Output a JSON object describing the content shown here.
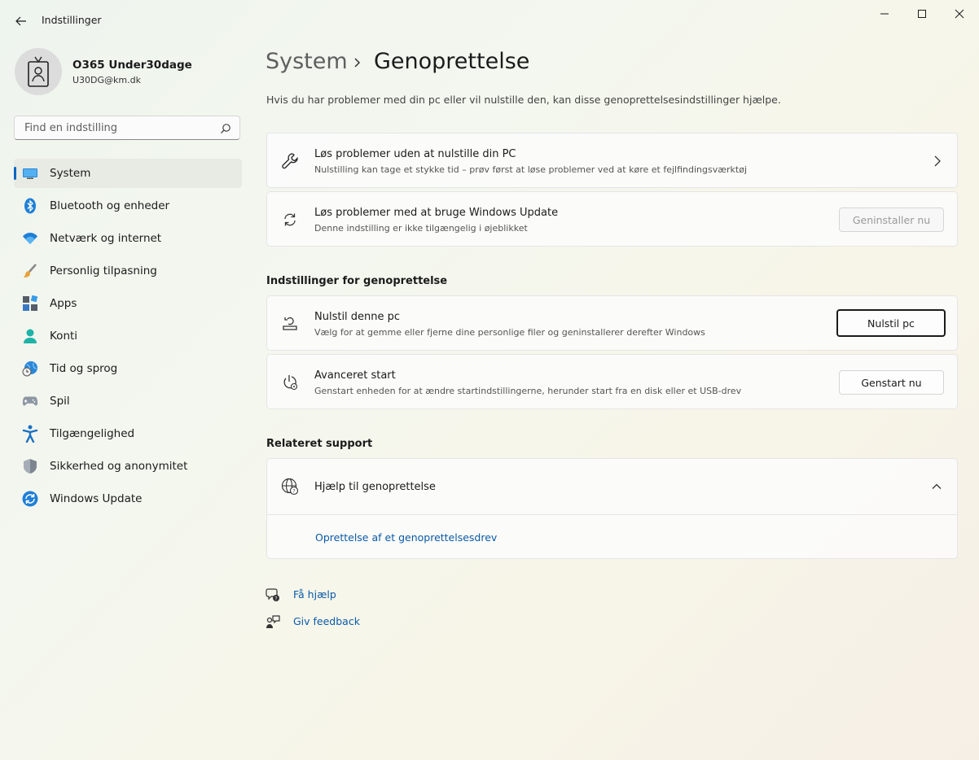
{
  "window": {
    "title": "Indstillinger"
  },
  "profile": {
    "name": "O365 Under30dage",
    "email": "U30DG@km.dk"
  },
  "search": {
    "placeholder": "Find en indstilling"
  },
  "nav": {
    "items": [
      {
        "label": "System",
        "icon": "system-icon",
        "active": true
      },
      {
        "label": "Bluetooth og enheder",
        "icon": "bluetooth-icon"
      },
      {
        "label": "Netværk og internet",
        "icon": "wifi-icon"
      },
      {
        "label": "Personlig tilpasning",
        "icon": "brush-icon"
      },
      {
        "label": "Apps",
        "icon": "apps-icon"
      },
      {
        "label": "Konti",
        "icon": "account-icon"
      },
      {
        "label": "Tid og sprog",
        "icon": "time-language-icon"
      },
      {
        "label": "Spil",
        "icon": "gamepad-icon"
      },
      {
        "label": "Tilgængelighed",
        "icon": "accessibility-icon"
      },
      {
        "label": "Sikkerhed og anonymitet",
        "icon": "shield-icon"
      },
      {
        "label": "Windows Update",
        "icon": "windows-update-icon"
      }
    ]
  },
  "header": {
    "breadcrumb_parent": "System",
    "breadcrumb_current": "Genoprettelse",
    "intro": "Hvis du har problemer med din pc eller vil nulstille den, kan disse genoprettelsesindstillinger hjælpe."
  },
  "cards": {
    "troubleshoot": {
      "title": "Løs problemer uden at nulstille din PC",
      "desc": "Nulstilling kan tage et stykke tid – prøv først at løse problemer ved at køre et fejlfindingsværktøj"
    },
    "windows_update": {
      "title": "Løs problemer med at bruge Windows Update",
      "desc": "Denne indstilling er ikke tilgængelig i øjeblikket",
      "button": "Geninstaller nu"
    }
  },
  "recovery_section": {
    "heading": "Indstillinger for genoprettelse",
    "reset": {
      "title": "Nulstil denne pc",
      "desc": "Vælg for at gemme eller fjerne dine personlige filer og geninstallerer derefter Windows",
      "button": "Nulstil pc"
    },
    "advanced": {
      "title": "Avanceret start",
      "desc": "Genstart enheden for at ændre startindstillingerne, herunder start fra en disk eller et USB-drev",
      "button": "Genstart nu"
    }
  },
  "support_section": {
    "heading": "Relateret support",
    "help": {
      "title": "Hjælp til genoprettelse",
      "link": "Oprettelse af et genoprettelsesdrev"
    }
  },
  "footer": {
    "get_help": "Få hjælp",
    "feedback": "Giv feedback"
  },
  "colors": {
    "accent": "#0067c0",
    "link": "#0a5aa8"
  }
}
